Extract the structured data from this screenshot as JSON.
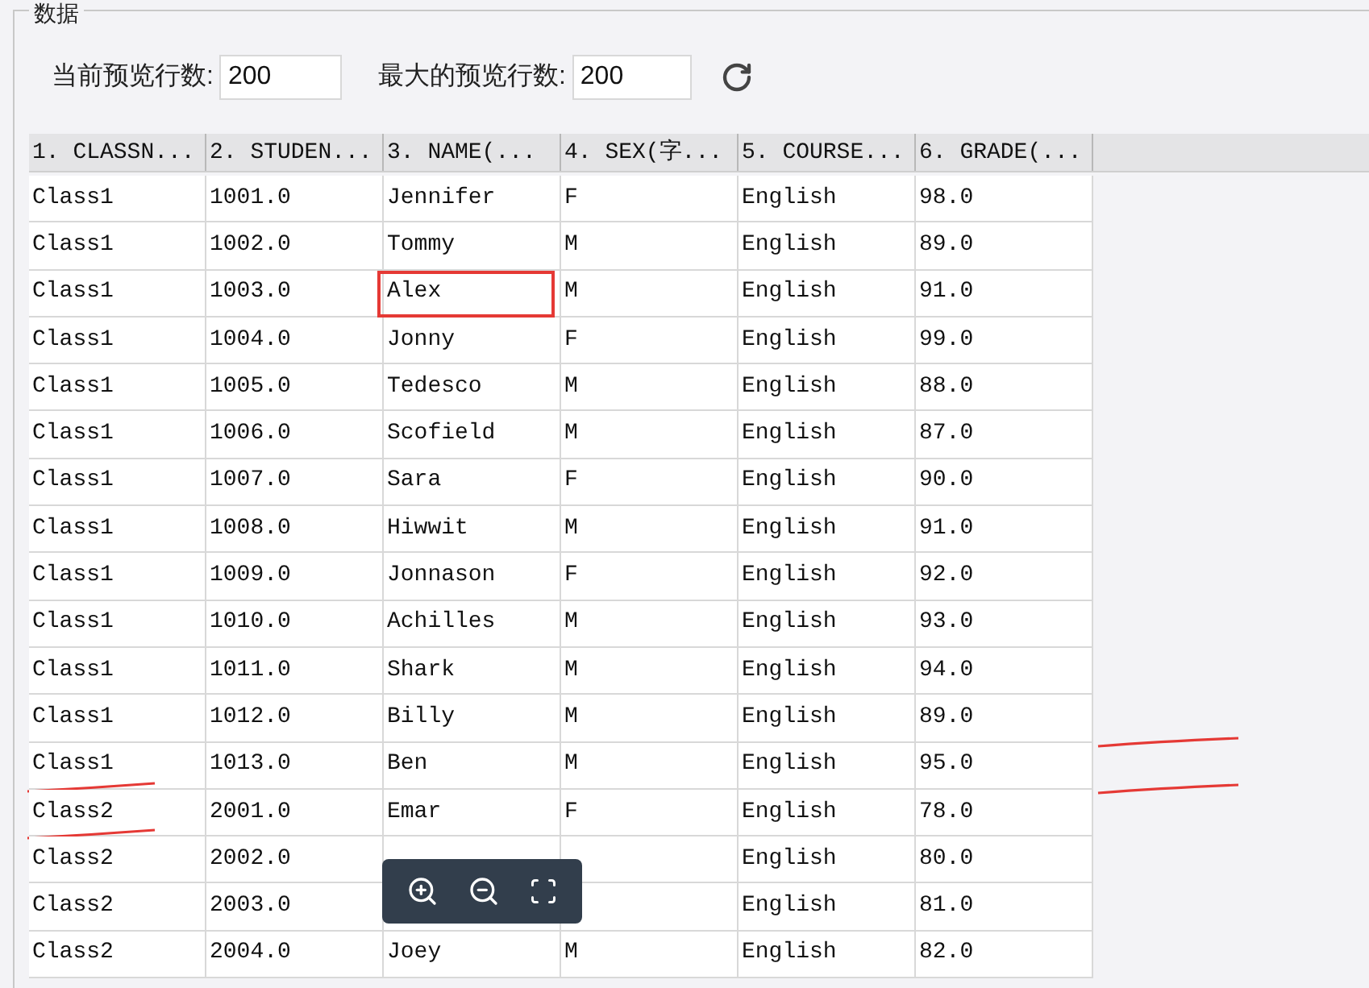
{
  "group": {
    "title": "数据"
  },
  "preview": {
    "current_label": "当前预览行数:",
    "current_value": "200",
    "max_label": "最大的预览行数:",
    "max_value": "200"
  },
  "table": {
    "columns": [
      "1. CLASSN...",
      "2. STUDEN...",
      "3. NAME(...",
      "4. SEX(字...",
      "5. COURSE...",
      "6. GRADE(..."
    ],
    "rows": [
      {
        "cells": [
          "Class1",
          "1001.0",
          "Jennifer",
          "F",
          "English",
          "98.0"
        ],
        "boxed": false,
        "underlined": false
      },
      {
        "cells": [
          "Class1",
          "1002.0",
          "Tommy",
          "M",
          "English",
          "89.0"
        ],
        "boxed": false,
        "underlined": false
      },
      {
        "cells": [
          "Class1",
          "1003.0",
          "Alex",
          "M",
          "English",
          "91.0"
        ],
        "boxed": true,
        "underlined": false
      },
      {
        "cells": [
          "Class1",
          "1004.0",
          "Jonny",
          "F",
          "English",
          "99.0"
        ],
        "boxed": false,
        "underlined": false
      },
      {
        "cells": [
          "Class1",
          "1005.0",
          "Tedesco",
          "M",
          "English",
          "88.0"
        ],
        "boxed": false,
        "underlined": false
      },
      {
        "cells": [
          "Class1",
          "1006.0",
          "Scofield",
          "M",
          "English",
          "87.0"
        ],
        "boxed": false,
        "underlined": false
      },
      {
        "cells": [
          "Class1",
          "1007.0",
          "Sara",
          "F",
          "English",
          "90.0"
        ],
        "boxed": false,
        "underlined": false
      },
      {
        "cells": [
          "Class1",
          "1008.0",
          "Hiwwit",
          "M",
          "English",
          "91.0"
        ],
        "boxed": false,
        "underlined": false
      },
      {
        "cells": [
          "Class1",
          "1009.0",
          "Jonnason",
          "F",
          "English",
          "92.0"
        ],
        "boxed": false,
        "underlined": false
      },
      {
        "cells": [
          "Class1",
          "1010.0",
          "Achilles",
          "M",
          "English",
          "93.0"
        ],
        "boxed": false,
        "underlined": false
      },
      {
        "cells": [
          "Class1",
          "1011.0",
          "Shark",
          "M",
          "English",
          "94.0"
        ],
        "boxed": false,
        "underlined": false
      },
      {
        "cells": [
          "Class1",
          "1012.0",
          "Billy",
          "M",
          "English",
          "89.0"
        ],
        "boxed": false,
        "underlined": false
      },
      {
        "cells": [
          "Class1",
          "1013.0",
          "Ben",
          "M",
          "English",
          "95.0"
        ],
        "boxed": false,
        "underlined": true
      },
      {
        "cells": [
          "Class2",
          "2001.0",
          "Emar",
          "F",
          "English",
          "78.0"
        ],
        "boxed": false,
        "underlined": true
      },
      {
        "cells": [
          "Class2",
          "2002.0",
          "",
          "",
          "English",
          "80.0"
        ],
        "boxed": false,
        "underlined": false
      },
      {
        "cells": [
          "Class2",
          "2003.0",
          "",
          "",
          "English",
          "81.0"
        ],
        "boxed": false,
        "underlined": false
      },
      {
        "cells": [
          "Class2",
          "2004.0",
          "Joey",
          "M",
          "English",
          "82.0"
        ],
        "boxed": false,
        "underlined": false
      }
    ]
  }
}
